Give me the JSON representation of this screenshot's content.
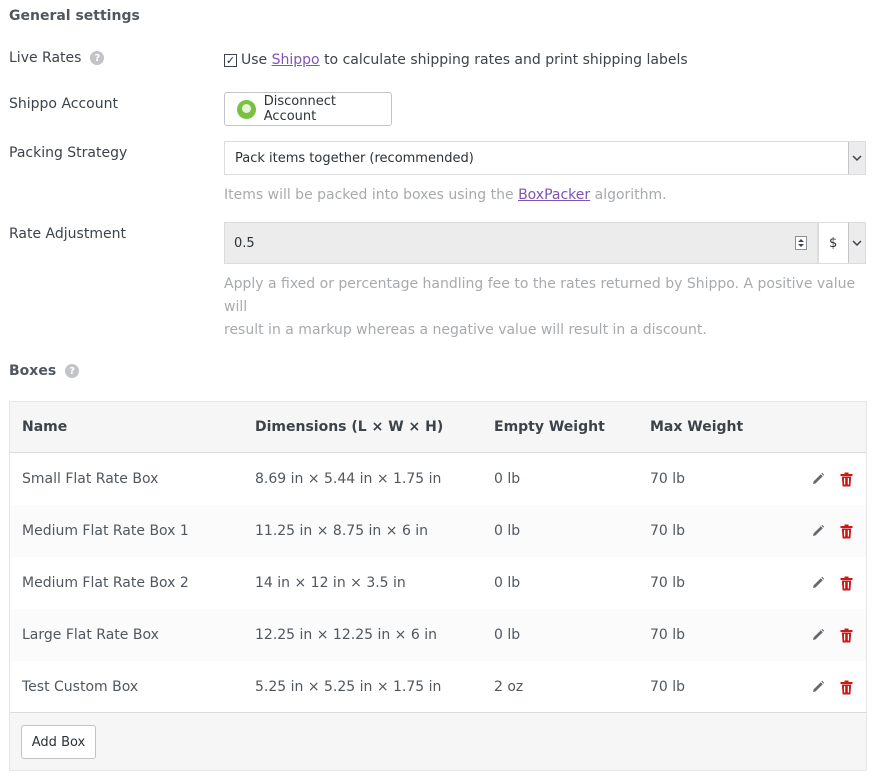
{
  "general": {
    "title": "General settings"
  },
  "live_rates": {
    "label": "Live Rates",
    "help": "?",
    "checkbox_mark": "✓",
    "text_before": "Use",
    "link_text": "Shippo",
    "text_after": "to calculate shipping rates and print shipping labels"
  },
  "shippo_account": {
    "label": "Shippo Account",
    "button_label": "Disconnect Account"
  },
  "packing": {
    "label": "Packing Strategy",
    "selected": "Pack items together (recommended)",
    "desc_before": "Items will be packed into boxes using the",
    "desc_link": "BoxPacker",
    "desc_after": "algorithm."
  },
  "rate_adjustment": {
    "label": "Rate Adjustment",
    "value": "0.5",
    "unit": "$",
    "description_line1": "Apply a fixed or percentage handling fee to the rates returned by Shippo. A positive value will",
    "description_line2": "result in a markup whereas a negative value will result in a discount."
  },
  "boxes": {
    "title": "Boxes",
    "help": "?",
    "columns": {
      "name": "Name",
      "dimensions": "Dimensions (L × W × H)",
      "empty_weight": "Empty Weight",
      "max_weight": "Max Weight"
    },
    "rows": [
      {
        "name": "Small Flat Rate Box",
        "dimensions": "8.69 in × 5.44 in × 1.75 in",
        "empty_weight": "0 lb",
        "max_weight": "70 lb"
      },
      {
        "name": "Medium Flat Rate Box 1",
        "dimensions": "11.25 in × 8.75 in × 6 in",
        "empty_weight": "0 lb",
        "max_weight": "70 lb"
      },
      {
        "name": "Medium Flat Rate Box 2",
        "dimensions": "14 in × 12 in × 3.5 in",
        "empty_weight": "0 lb",
        "max_weight": "70 lb"
      },
      {
        "name": "Large Flat Rate Box",
        "dimensions": "12.25 in × 12.25 in × 6 in",
        "empty_weight": "0 lb",
        "max_weight": "70 lb"
      },
      {
        "name": "Test Custom Box",
        "dimensions": "5.25 in × 5.25 in × 1.75 in",
        "empty_weight": "2 oz",
        "max_weight": "70 lb"
      }
    ],
    "add_button": "Add Box"
  },
  "colors": {
    "link": "#7f54b3",
    "delete": "#cc1818",
    "edit": "#646970"
  }
}
